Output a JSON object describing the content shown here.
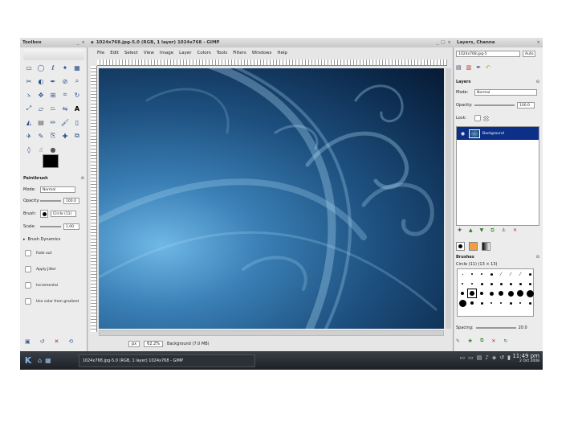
{
  "toolbox": {
    "title": "Toolbox",
    "options_title": "Paintbrush",
    "mode_label": "Mode:",
    "mode_value": "Normal",
    "opacity_label": "Opacity:",
    "opacity_value": "100.0",
    "brush_label": "Brush:",
    "brush_value": "Circle (11)",
    "scale_label": "Scale:",
    "scale_value": "1.00",
    "dynamics_label": "Brush Dynamics",
    "checks": [
      "Fade out",
      "Apply Jitter",
      "Incremental",
      "Use color from gradient"
    ]
  },
  "image_window": {
    "title": "1024x768.jpg-5.0 (RGB, 1 layer) 1024x768 - GIMP",
    "menu": [
      "File",
      "Edit",
      "Select",
      "View",
      "Image",
      "Layer",
      "Colors",
      "Tools",
      "Filters",
      "Windows",
      "Help"
    ],
    "unit": "px",
    "zoom": "62.2%",
    "status": "Background (7.0 MB)"
  },
  "dock": {
    "title": "Layers, Channe",
    "image_select": "1024x768.jpg-5",
    "auto_label": "Auto",
    "layers_title": "Layers",
    "mode_label": "Mode:",
    "mode_value": "Normal",
    "opacity_label": "Opacity:",
    "opacity_value": "100.0",
    "lock_label": "Lock:",
    "layer_name": "Background",
    "brushes_title": "Brushes",
    "brush_info": "Circle (11) (13 × 13)",
    "spacing_label": "Spacing:",
    "spacing_value": "20.0"
  },
  "taskbar": {
    "task_label": "1024x768.jpg-5.0 (RGB, 1 layer) 1024x768 - GIMP",
    "time": "11:49 pm",
    "date": "2 Oct 2008"
  },
  "colors": {
    "canvas_deep": "#0c2a4c",
    "canvas_light": "#6fb8e6",
    "selection": "#0c2f87"
  }
}
